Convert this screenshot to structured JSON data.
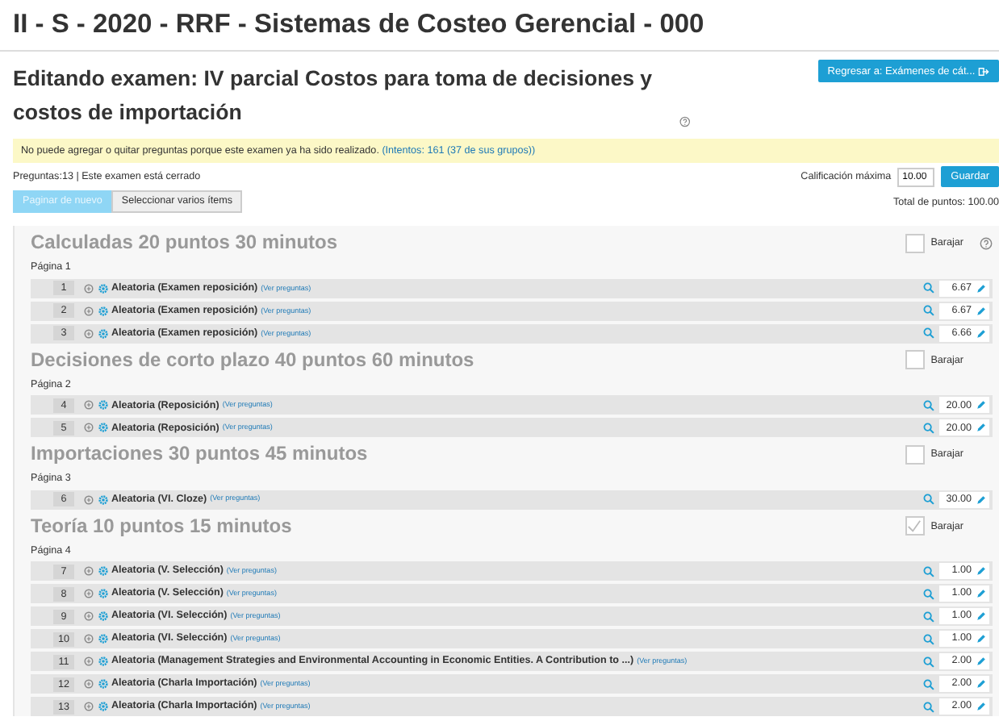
{
  "course_title": "II - S - 2020 - RRF - Sistemas de Costeo Gerencial - 000",
  "heading": "Editando examen: IV parcial Costos para toma de decisiones y costos de importación",
  "back_button": "Regresar a: Exámenes de cát...",
  "notice": {
    "text": "No puede agregar o quitar preguntas porque este examen ya ha sido realizado.",
    "link": "(Intentos: 161 (37 de sus grupos))"
  },
  "summary": "Preguntas:13 | Este examen está cerrado",
  "max_grade": {
    "label": "Calificación máxima",
    "value": "10.00",
    "button": "Guardar"
  },
  "actions": [
    {
      "label": "Paginar de nuevo",
      "disabled": true
    },
    {
      "label": "Seleccionar varios ítems",
      "disabled": false
    }
  ],
  "total": "Total de puntos: 100.00",
  "sections": [
    {
      "title": "Calculadas 20 puntos 30 minutos",
      "shuffle_label": "Barajar",
      "shuffle": false,
      "help": true,
      "pages": [
        {
          "label": "Página 1",
          "slots": [
            {
              "number": "1",
              "name": "Aleatoria (Examen reposición)",
              "link": "(Ver preguntas)",
              "mark": "6.67"
            },
            {
              "number": "2",
              "name": "Aleatoria (Examen reposición)",
              "link": "(Ver preguntas)",
              "mark": "6.67"
            },
            {
              "number": "3",
              "name": "Aleatoria (Examen reposición)",
              "link": "(Ver preguntas)",
              "mark": "6.66"
            }
          ]
        }
      ]
    },
    {
      "title": "Decisiones de corto plazo 40 puntos 60 minutos",
      "shuffle_label": "Barajar",
      "shuffle": false,
      "help": false,
      "pages": [
        {
          "label": "Página 2",
          "slots": [
            {
              "number": "4",
              "name": "Aleatoria (Reposición)",
              "link": "(Ver preguntas)",
              "mark": "20.00"
            },
            {
              "number": "5",
              "name": "Aleatoria (Reposición)",
              "link": "(Ver preguntas)",
              "mark": "20.00"
            }
          ]
        }
      ]
    },
    {
      "title": "Importaciones 30 puntos 45 minutos",
      "shuffle_label": "Barajar",
      "shuffle": false,
      "help": false,
      "pages": [
        {
          "label": "Página 3",
          "slots": [
            {
              "number": "6",
              "name": "Aleatoria (VI. Cloze)",
              "link": "(Ver preguntas)",
              "mark": "30.00"
            }
          ]
        }
      ]
    },
    {
      "title": "Teoría 10 puntos 15 minutos",
      "shuffle_label": "Barajar",
      "shuffle": true,
      "help": false,
      "pages": [
        {
          "label": "Página 4",
          "slots": [
            {
              "number": "7",
              "name": "Aleatoria (V. Selección)",
              "link": "(Ver preguntas)",
              "mark": "1.00"
            },
            {
              "number": "8",
              "name": "Aleatoria (V. Selección)",
              "link": "(Ver preguntas)",
              "mark": "1.00"
            },
            {
              "number": "9",
              "name": "Aleatoria (VI. Selección)",
              "link": "(Ver preguntas)",
              "mark": "1.00"
            },
            {
              "number": "10",
              "name": "Aleatoria (VI. Selección)",
              "link": "(Ver preguntas)",
              "mark": "1.00"
            },
            {
              "number": "11",
              "name": "Aleatoria (Management Strategies and Environmental Accounting in Economic Entities. A Contribution to ...)",
              "link": "(Ver preguntas)",
              "mark": "2.00"
            },
            {
              "number": "12",
              "name": "Aleatoria (Charla Importación)",
              "link": "(Ver preguntas)",
              "mark": "2.00"
            },
            {
              "number": "13",
              "name": "Aleatoria (Charla Importación)",
              "link": "(Ver preguntas)",
              "mark": "2.00"
            }
          ]
        }
      ]
    }
  ]
}
